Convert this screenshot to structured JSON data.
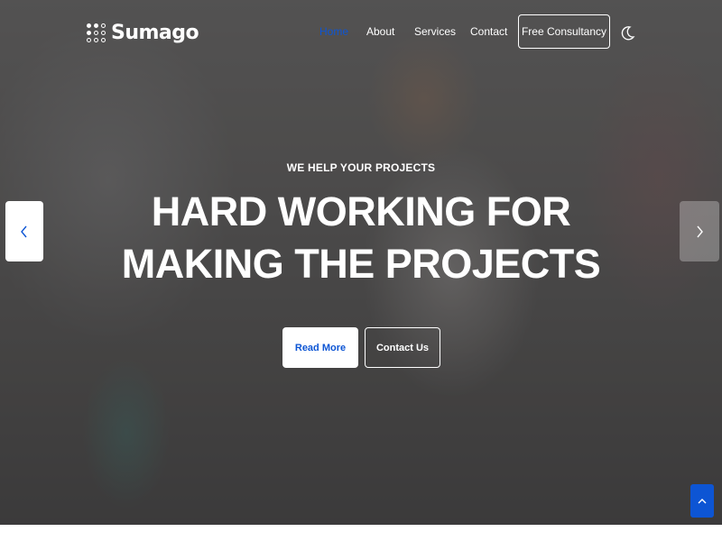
{
  "brand": {
    "name": "Sumago",
    "accent_color": "#0d55d4"
  },
  "nav": {
    "items": [
      {
        "label": "Home",
        "active": true
      },
      {
        "label": "About",
        "active": false
      },
      {
        "label": "Services",
        "active": false
      },
      {
        "label": "Contact",
        "active": false
      }
    ],
    "cta_label": "Free Consultancy",
    "theme_toggle_icon": "moon-icon"
  },
  "hero": {
    "eyebrow": "WE HELP YOUR PROJECTS",
    "headline": "HARD WORKING FOR MAKING THE PROJECTS",
    "primary_button": "Read More",
    "secondary_button": "Contact Us"
  },
  "slider": {
    "prev_icon": "chevron-left-icon",
    "next_icon": "chevron-right-icon"
  },
  "back_to_top_icon": "chevron-up-icon"
}
